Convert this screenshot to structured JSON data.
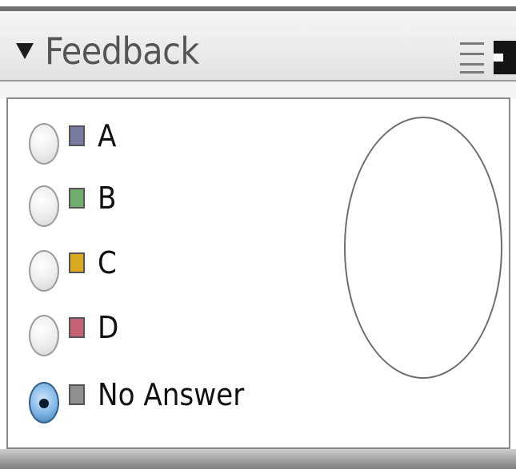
{
  "panel": {
    "title": "Feedback"
  },
  "options": [
    {
      "label": "A",
      "color": "#7a7a9e",
      "selected": false
    },
    {
      "label": "B",
      "color": "#6fae6f",
      "selected": false
    },
    {
      "label": "C",
      "color": "#d9a923",
      "selected": false
    },
    {
      "label": "D",
      "color": "#c56175",
      "selected": false
    },
    {
      "label": "No Answer",
      "color": "#8f8f8f",
      "selected": true
    }
  ],
  "icons": {
    "collapse": "triangle-down-icon",
    "menu": "panel-menu-icon"
  }
}
